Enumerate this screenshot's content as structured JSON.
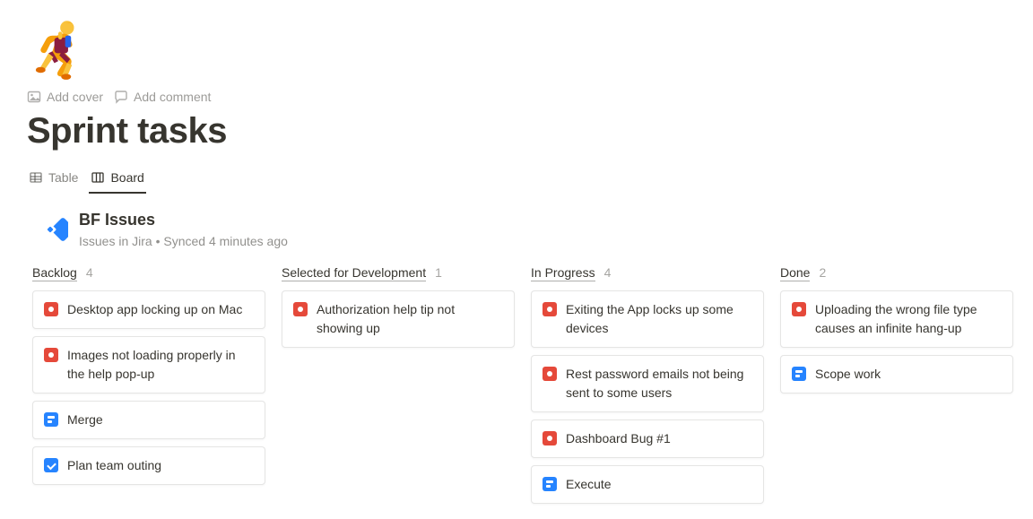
{
  "hero_emoji": "🏃",
  "actions": {
    "add_cover": "Add cover",
    "add_comment": "Add comment"
  },
  "page_title": "Sprint tasks",
  "tabs": {
    "table": "Table",
    "board": "Board"
  },
  "database": {
    "title": "BF Issues",
    "subtitle": "Issues in Jira  •  Synced 4 minutes ago"
  },
  "columns": [
    {
      "name": "Backlog",
      "count": "4",
      "cards": [
        {
          "icon": "bug",
          "text": "Desktop app locking up on Mac"
        },
        {
          "icon": "bug",
          "text": "Images not loading properly in the help pop-up"
        },
        {
          "icon": "sub",
          "text": "Merge"
        },
        {
          "icon": "check",
          "text": "Plan team outing"
        }
      ]
    },
    {
      "name": "Selected for Development",
      "count": "1",
      "cards": [
        {
          "icon": "bug",
          "text": "Authorization help tip not showing up"
        }
      ]
    },
    {
      "name": "In Progress",
      "count": "4",
      "cards": [
        {
          "icon": "bug",
          "text": "Exiting the App locks up some devices"
        },
        {
          "icon": "bug",
          "text": "Rest password emails not being sent to some users"
        },
        {
          "icon": "bug",
          "text": "Dashboard Bug #1"
        },
        {
          "icon": "sub",
          "text": "Execute"
        }
      ]
    },
    {
      "name": "Done",
      "count": "2",
      "cards": [
        {
          "icon": "bug",
          "text": "Uploading the wrong file type causes an infinite hang-up"
        },
        {
          "icon": "sub",
          "text": "Scope work"
        }
      ]
    }
  ]
}
